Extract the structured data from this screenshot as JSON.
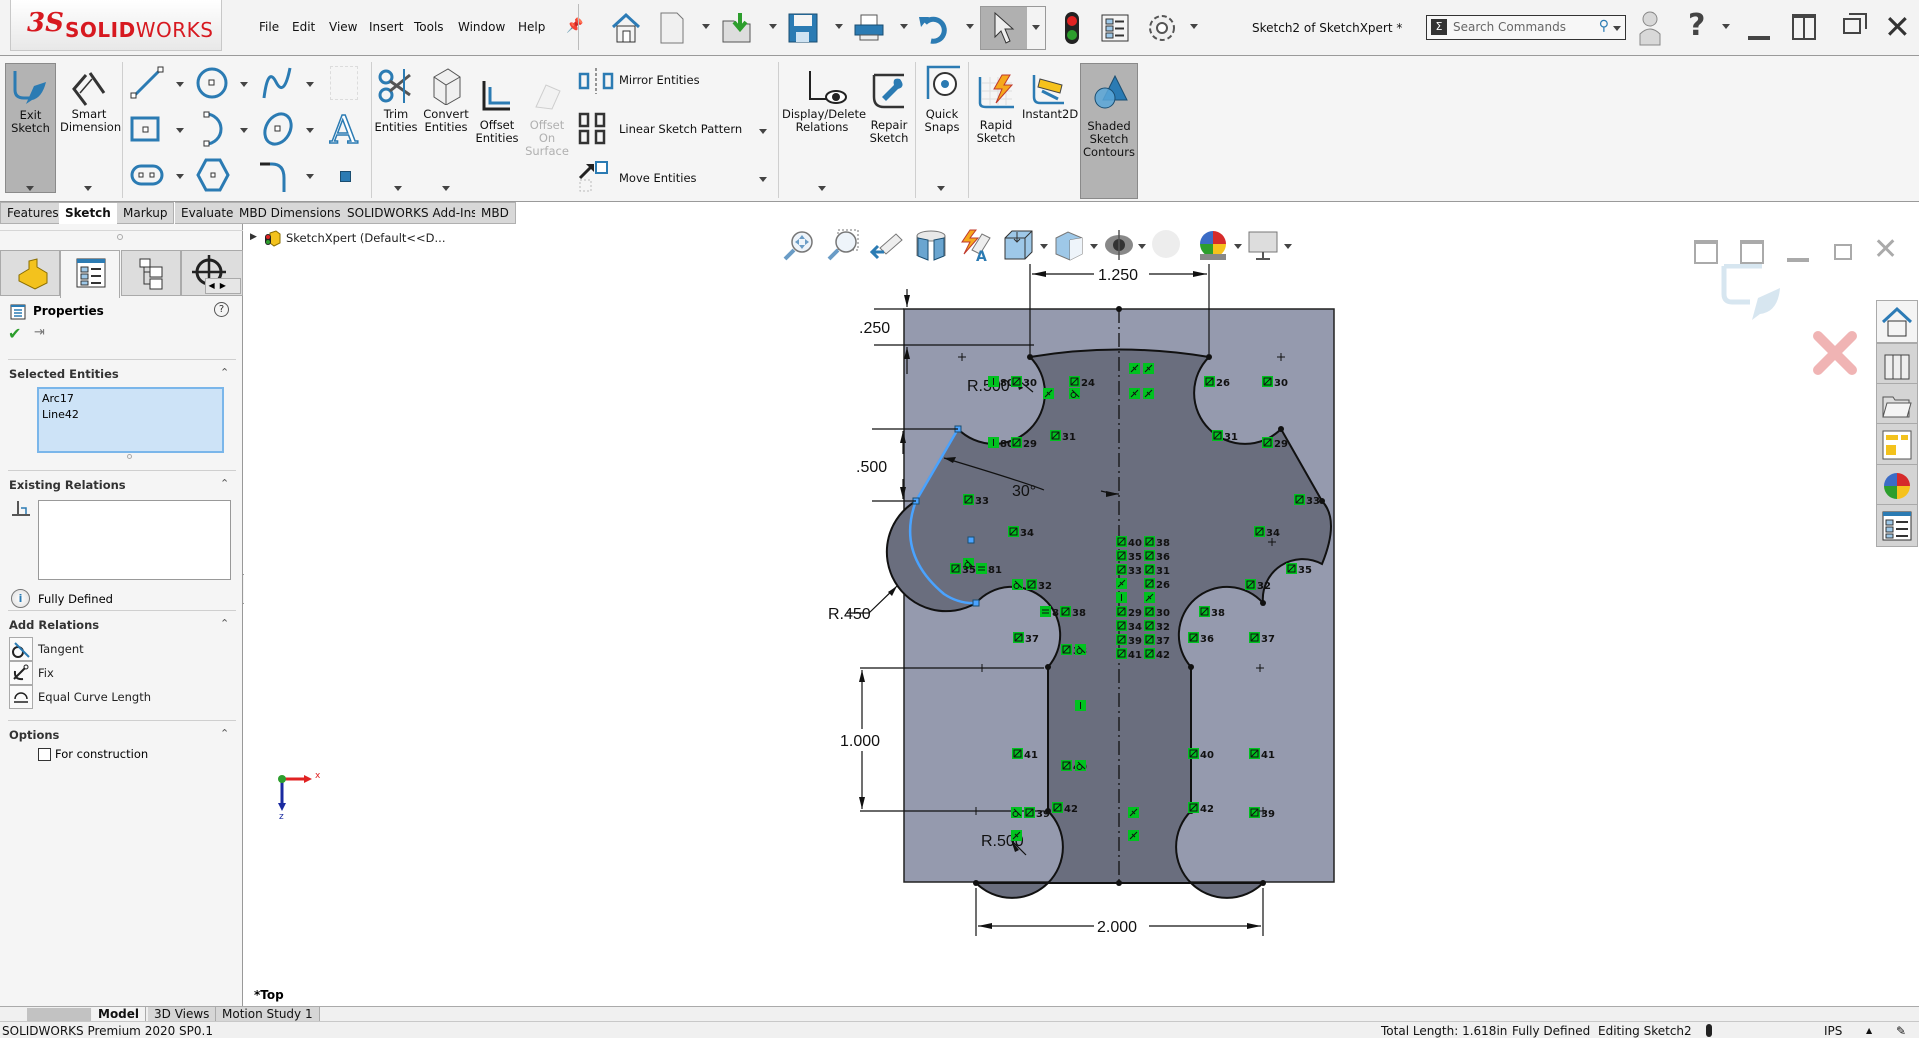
{
  "app": {
    "logo_prefix": "3S",
    "logo_bold": "SOLID",
    "logo_light": "WORKS",
    "document_title": "Sketch2 of SketchXpert *"
  },
  "menu": [
    "File",
    "Edit",
    "View",
    "Insert",
    "Tools",
    "Window",
    "Help"
  ],
  "quick_access": [
    "home-icon",
    "new-document-icon",
    "open-icon",
    "save-icon",
    "print-icon",
    "undo-icon",
    "select-icon",
    "rebuild-icon",
    "file-properties-icon",
    "options-icon"
  ],
  "search": {
    "placeholder": "Search Commands"
  },
  "ribbon": {
    "exit_sketch": "Exit\nSketch",
    "smart_dimension": "Smart\nDimension",
    "trim": "Trim\nEntities",
    "convert": "Convert\nEntities",
    "offset": "Offset\nEntities",
    "offset_surface": "Offset\nOn\nSurface",
    "mirror": "Mirror Entities",
    "linear_pattern": "Linear Sketch Pattern",
    "move": "Move Entities",
    "display_delete": "Display/Delete\nRelations",
    "repair": "Repair\nSketch",
    "quick_snaps": "Quick\nSnaps",
    "rapid": "Rapid\nSketch",
    "instant2d": "Instant2D",
    "shaded": "Shaded\nSketch\nContours"
  },
  "tabs": [
    {
      "label": "Features",
      "active": false
    },
    {
      "label": "Sketch",
      "active": true
    },
    {
      "label": "Markup",
      "active": false
    },
    {
      "label": "Evaluate",
      "active": false
    },
    {
      "label": "MBD Dimensions",
      "active": false
    },
    {
      "label": "SOLIDWORKS Add-Ins",
      "active": false
    },
    {
      "label": "MBD",
      "active": false
    }
  ],
  "tree": {
    "root": "SketchXpert  (Default<<D..."
  },
  "property_manager": {
    "title": "Properties",
    "selected_entities_header": "Selected Entities",
    "selected_entities": [
      "Arc17",
      "Line42"
    ],
    "existing_relations_header": "Existing Relations",
    "status": "Fully Defined",
    "add_relations_header": "Add Relations",
    "relations": [
      "Tangent",
      "Fix",
      "Equal Curve Length"
    ],
    "options_header": "Options",
    "for_construction_label": "For construction",
    "for_construction_checked": false
  },
  "sketch": {
    "dims": {
      "top_width": "1.250",
      "top_offset": ".250",
      "upper_radius": "R.500",
      "side_height": ".500",
      "angle": "30°",
      "side_radius": "R.450",
      "stem_height": "1.000",
      "lower_radius": "R.500",
      "bottom_width": "2.000"
    },
    "view_label": "*Top",
    "triad": {
      "x": "x",
      "z": "z"
    }
  },
  "bottom_tabs": [
    {
      "label": "Model",
      "active": true
    },
    {
      "label": "3D Views",
      "active": false
    },
    {
      "label": "Motion Study 1",
      "active": false
    }
  ],
  "status_bar": {
    "product": "SOLIDWORKS Premium 2020 SP0.1",
    "total_length": "Total Length: 1.618in",
    "definition": "Fully Defined",
    "editing": "Editing Sketch2",
    "units": "IPS"
  },
  "colors": {
    "accent": "#1f6fb5",
    "selection": "#4aa3ff",
    "relation_green": "#00c21f",
    "sketch_fill": "#6a6e7e",
    "region_fill": "#959aae"
  }
}
